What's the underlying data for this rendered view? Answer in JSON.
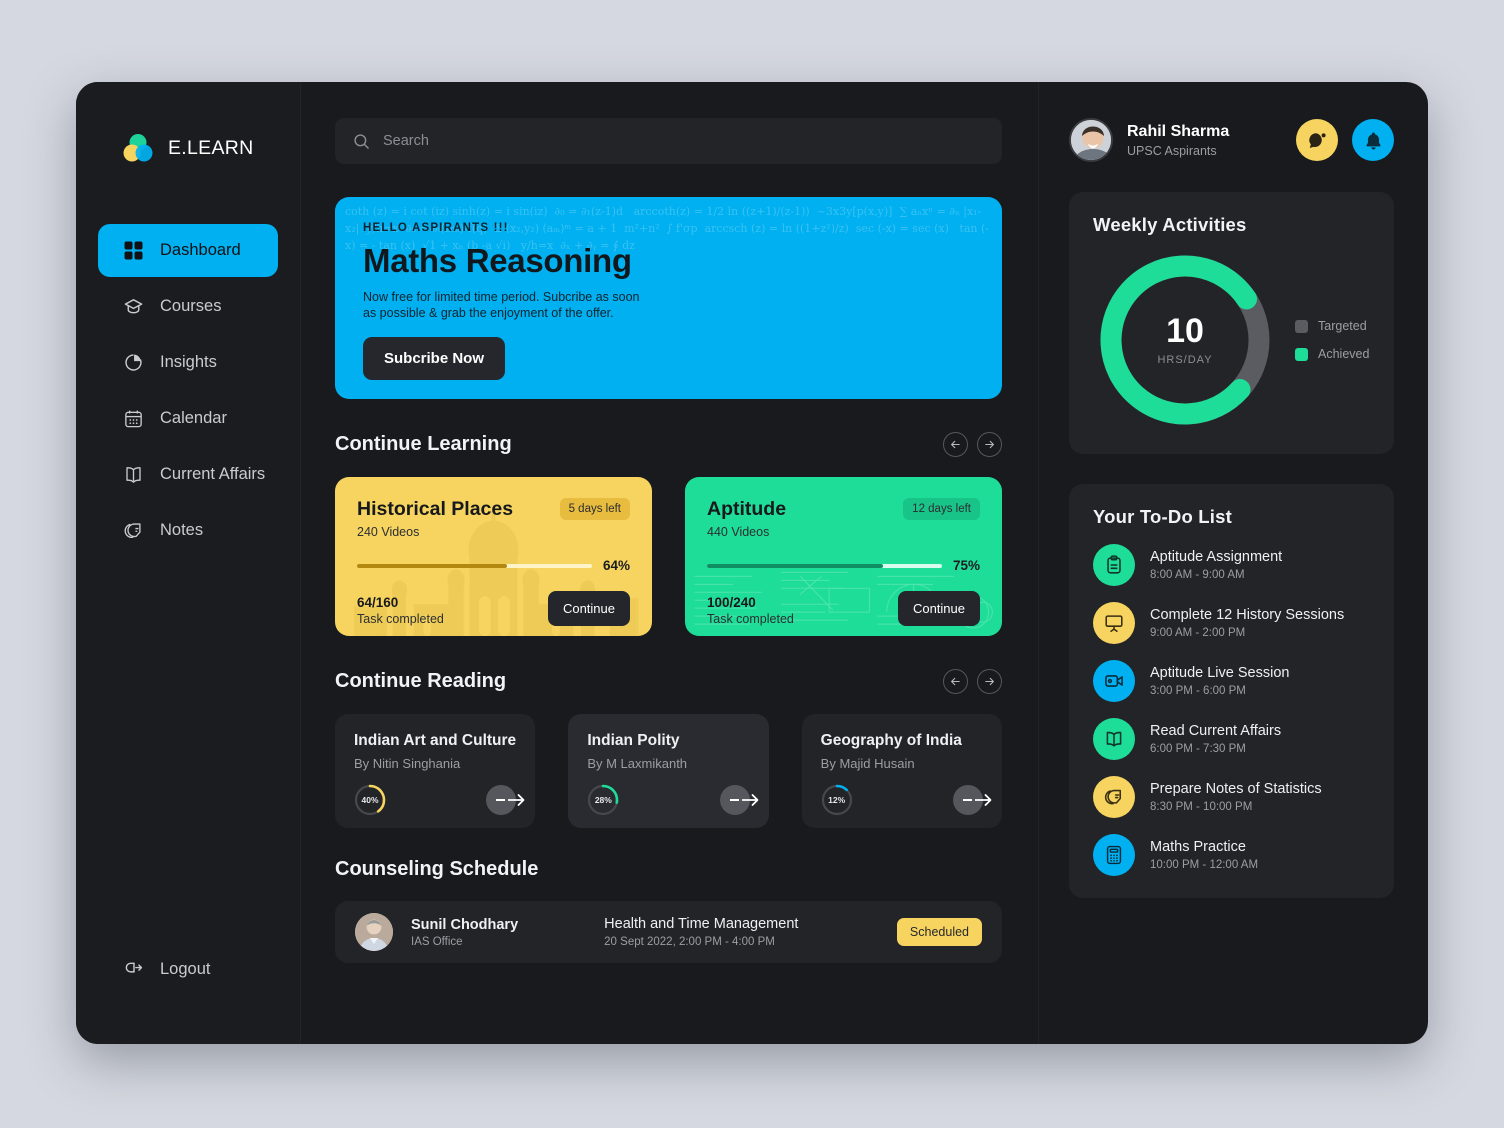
{
  "brand": {
    "name": "E.LEARN",
    "logo_icon": "three-circles-logo",
    "colors": {
      "green": "#1dd39a",
      "yellow": "#f6d45f",
      "blue": "#00b0f0"
    }
  },
  "sidebar": {
    "items": [
      {
        "label": "Dashboard",
        "icon": "grid-icon",
        "active": true
      },
      {
        "label": "Courses",
        "icon": "graduation-cap-icon",
        "active": false
      },
      {
        "label": "Insights",
        "icon": "pie-chart-icon",
        "active": false
      },
      {
        "label": "Calendar",
        "icon": "calendar-icon",
        "active": false
      },
      {
        "label": "Current Affairs",
        "icon": "open-book-icon",
        "active": false
      },
      {
        "label": "Notes",
        "icon": "sticky-note-icon",
        "active": false
      }
    ],
    "logout": {
      "label": "Logout",
      "icon": "logout-icon"
    }
  },
  "search": {
    "placeholder": "Search",
    "value": "",
    "icon": "search-icon"
  },
  "hero": {
    "kicker": "HELLO  ASPIRANTS !!!",
    "title": "Maths Reasoning",
    "subtitle": "Now free for limited time period. Subcribe as soon as possible & grab the enjoyment of the offer.",
    "button": "Subcribe Now",
    "bg_color": "#00b0f0",
    "formula_watermark": "coth (z) = i cot (iz) sinh(z) = i sin(iz)  ∂₀ = ∂₁(z-1)d   arccoth(z) = 1/2 ln ((z+1)/(z-1))  ~3x3y[p(x,y)]  ∑ aₙxⁿ = ∂ₙ |x₁-x₂|  y/h=x  ∂₀ = ∂ₜ(z₀ₕ)-f(q)  Σ (x₂,y₂) (aₘ)ᵐ = a + 1  m²+n²  ∫ f'σp  arccsch (z) = ln ((1+z²)/z)  sec (-x) = sec (x)   tan (-x) = - tan (x)  √1 + xₙ (b -a √i)   y/h=x  ∂ₓ + ∂ᵧ = ∮ dz"
  },
  "continue_learning": {
    "title": "Continue Learning",
    "prev_icon": "arrow-left-icon",
    "next_icon": "arrow-right-icon",
    "cards": [
      {
        "title": "Historical Places",
        "videos": "240 Videos",
        "badge": "5 days left",
        "percent": "64%",
        "progress": 64,
        "count": "64/160",
        "task_label": "Task completed",
        "button": "Continue",
        "theme": "yellow",
        "color": "#f6d45f"
      },
      {
        "title": "Aptitude",
        "videos": "440 Videos",
        "badge": "12 days left",
        "percent": "75%",
        "progress": 75,
        "count": "100/240",
        "task_label": "Task completed",
        "button": "Continue",
        "theme": "green",
        "color": "#1edd99"
      }
    ]
  },
  "continue_reading": {
    "title": "Continue Reading",
    "prev_icon": "arrow-left-icon",
    "next_icon": "arrow-right-icon",
    "cards": [
      {
        "title": "Indian Art and Culture",
        "author": "By Nitin Singhania",
        "percent": "40%",
        "progress": 40,
        "ring_color": "#f6d45f"
      },
      {
        "title": "Indian Polity",
        "author": "By M Laxmikanth",
        "percent": "28%",
        "progress": 28,
        "ring_color": "#1edd99"
      },
      {
        "title": "Geography of India",
        "author": "By Majid Husain",
        "percent": "12%",
        "progress": 12,
        "ring_color": "#00b0f0"
      }
    ]
  },
  "counseling": {
    "title": "Counseling Schedule",
    "row": {
      "name": "Sunil Chodhary",
      "role": "IAS Office",
      "topic": "Health and Time Management",
      "time": "20 Sept 2022, 2:00 PM - 4:00 PM",
      "status": "Scheduled",
      "avatar_icon": "avatar"
    }
  },
  "profile": {
    "name": "Rahil Sharma",
    "role": "UPSC Aspirants",
    "avatar_icon": "avatar",
    "message_icon": "message-icon",
    "bell_icon": "bell-icon"
  },
  "weekly": {
    "title": "Weekly  Activities",
    "value": "10",
    "unit": "HRS/DAY",
    "legend": [
      {
        "label": "Targeted",
        "color": "#5a5c61"
      },
      {
        "label": "Achieved",
        "color": "#1edd99"
      }
    ]
  },
  "chart_data": {
    "type": "pie",
    "title": "Weekly  Activities",
    "center_value": "10",
    "center_unit": "HRS/DAY",
    "labels": [
      "Achieved",
      "Targeted"
    ],
    "values": [
      79,
      21
    ],
    "colors": [
      "#1edd99",
      "#5a5c61"
    ],
    "legend_position": "right",
    "donut": true
  },
  "todo": {
    "title": "Your To-Do List",
    "items": [
      {
        "title": "Aptitude Assignment",
        "time": "8:00 AM - 9:00 AM",
        "icon": "clipboard-icon",
        "color": "#1edd99"
      },
      {
        "title": "Complete 12 History Sessions",
        "time": "9:00 AM - 2:00 PM",
        "icon": "presentation-icon",
        "color": "#f6d45f"
      },
      {
        "title": "Aptitude Live Session",
        "time": "3:00 PM - 6:00 PM",
        "icon": "video-camera-icon",
        "color": "#00b0f0"
      },
      {
        "title": "Read Current Affairs",
        "time": "6:00 PM - 7:30 PM",
        "icon": "open-book-icon",
        "color": "#1edd99"
      },
      {
        "title": "Prepare Notes of Statistics",
        "time": "8:30 PM - 10:00 PM",
        "icon": "sticky-note-icon",
        "color": "#f6d45f"
      },
      {
        "title": "Maths Practice",
        "time": "10:00 PM - 12:00 AM",
        "icon": "calculator-icon",
        "color": "#00b0f0"
      }
    ]
  }
}
